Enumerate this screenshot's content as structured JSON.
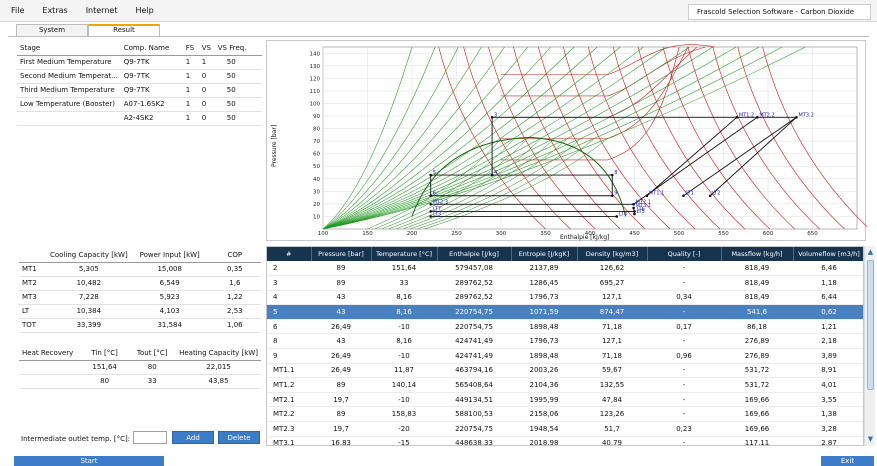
{
  "menu": {
    "items": [
      "File",
      "Extras",
      "Internet",
      "Help"
    ]
  },
  "window_title": "Frascold Selection Software - Carbon Dioxide",
  "tabs": [
    {
      "label": "System"
    },
    {
      "label": "Result"
    }
  ],
  "stage_table": {
    "headers": [
      "Stage",
      "Comp. Name",
      "FS",
      "VS",
      "VS Freq."
    ],
    "rows": [
      [
        "First Medium Temperature",
        "Q9-7TK",
        "1",
        "1",
        "50"
      ],
      [
        "Second Medium Temperat...",
        "Q9-7TK",
        "1",
        "0",
        "50"
      ],
      [
        "Third Medium Temperature",
        "Q9-7TK",
        "1",
        "0",
        "50"
      ],
      [
        "Low Temperature (Booster)",
        "A07-1.6SK2",
        "1",
        "0",
        "50"
      ],
      [
        "",
        "A2-4SK2",
        "1",
        "0",
        "50"
      ]
    ]
  },
  "capacity_table": {
    "headers": [
      "",
      "Cooling Capacity [kW]",
      "Power Input [kW]",
      "COP"
    ],
    "rows": [
      [
        "MT1",
        "5,305",
        "15,008",
        "0,35"
      ],
      [
        "MT2",
        "10,482",
        "6,549",
        "1,6"
      ],
      [
        "MT3",
        "7,228",
        "5,923",
        "1,22"
      ],
      [
        "LT",
        "10,384",
        "4,103",
        "2,53"
      ],
      [
        "TOT",
        "33,399",
        "31,584",
        "1,06"
      ]
    ]
  },
  "heat_recovery_table": {
    "headers": [
      "Heat Recovery",
      "Tin [°C]",
      "Tout [°C]",
      "Heating Capacity [kW]"
    ],
    "rows": [
      [
        "",
        "151,64",
        "80",
        "22,015"
      ],
      [
        "",
        "80",
        "33",
        "43,85"
      ]
    ]
  },
  "intermediate": {
    "label": "Intermediate outlet temp. [°C]:",
    "value": ""
  },
  "buttons": {
    "add": "Add",
    "delete": "Delete",
    "start": "Start",
    "exit": "Exit"
  },
  "grid": {
    "headers": [
      "#",
      "Pressure [bar]",
      "Temperature [°C]",
      "Enthalpie [J/kg]",
      "Entropie [J/kgK]",
      "Density [kg/m3]",
      "Quality [-]",
      "Massflow [kg/h]",
      "Volumeflow [m3/h]"
    ],
    "rows": [
      [
        "2",
        "89",
        "151,64",
        "579457,08",
        "2137,89",
        "126,62",
        "-",
        "818,49",
        "6,46"
      ],
      [
        "3",
        "89",
        "33",
        "289762,52",
        "1286,45",
        "695,27",
        "-",
        "818,49",
        "1,18"
      ],
      [
        "4",
        "43",
        "8,16",
        "289762,52",
        "1796,73",
        "127,1",
        "0,34",
        "818,49",
        "6,44"
      ],
      [
        "5",
        "43",
        "8,16",
        "220754,75",
        "1071,59",
        "874,47",
        "-",
        "541,6",
        "0,62"
      ],
      [
        "6",
        "26,49",
        "-10",
        "220754,75",
        "1898,48",
        "71,18",
        "0,17",
        "86,18",
        "1,21"
      ],
      [
        "8",
        "43",
        "8,16",
        "424741,49",
        "1796,73",
        "127,1",
        "-",
        "276,89",
        "2,18"
      ],
      [
        "9",
        "26,49",
        "-10",
        "424741,49",
        "1898,48",
        "71,18",
        "0,96",
        "276,89",
        "3,89"
      ],
      [
        "MT1.1",
        "26,49",
        "11,87",
        "463794,16",
        "2003,26",
        "59,67",
        "-",
        "531,72",
        "8,91"
      ],
      [
        "MT1.2",
        "89",
        "140,14",
        "565408,64",
        "2104,36",
        "132,55",
        "-",
        "531,72",
        "4,01"
      ],
      [
        "MT2.1",
        "19,7",
        "-10",
        "449134,51",
        "1995,99",
        "47,84",
        "-",
        "169,66",
        "3,55"
      ],
      [
        "MT2.2",
        "89",
        "158,83",
        "588100,53",
        "2158,06",
        "123,26",
        "-",
        "169,66",
        "1,38"
      ],
      [
        "MT2.3",
        "19,7",
        "-20",
        "220754,75",
        "1948,54",
        "51,7",
        "0,23",
        "169,66",
        "3,28"
      ],
      [
        "MT3.1",
        "16,83",
        "-15",
        "448638,33",
        "2018,98",
        "40,79",
        "-",
        "117,11",
        "2,87"
      ]
    ],
    "selected_row_index": 3
  },
  "chart_data": {
    "type": "line",
    "xlabel": "Enthalpie [kJ/kg]",
    "ylabel": "Pressure [bar]",
    "xlim": [
      100,
      700
    ],
    "ylim": [
      0,
      145
    ],
    "x_ticks": [
      100,
      150,
      200,
      250,
      300,
      350,
      400,
      450,
      500,
      550,
      600,
      650
    ],
    "y_ticks": [
      10,
      20,
      30,
      40,
      50,
      60,
      70,
      80,
      90,
      100,
      110,
      120,
      130,
      140
    ],
    "points": [
      {
        "label": "3",
        "h": 290,
        "p": 89
      },
      {
        "label": "4",
        "h": 290,
        "p": 43
      },
      {
        "label": "5",
        "h": 221,
        "p": 43
      },
      {
        "label": "6",
        "h": 221,
        "p": 26.5
      },
      {
        "label": "8",
        "h": 425,
        "p": 43
      },
      {
        "label": "9",
        "h": 425,
        "p": 26.5
      },
      {
        "label": "MT1.1",
        "h": 464,
        "p": 26.5
      },
      {
        "label": "MT1.2",
        "h": 565,
        "p": 89
      },
      {
        "label": "MT2.1",
        "h": 449,
        "p": 19.7
      },
      {
        "label": "MT2.2",
        "h": 588,
        "p": 89
      },
      {
        "label": "MT2.3",
        "h": 221,
        "p": 19.7
      },
      {
        "label": "MT3.1",
        "h": 449,
        "p": 16.8
      },
      {
        "label": "LT1",
        "h": 505,
        "p": 26.5
      },
      {
        "label": "MT3.2",
        "h": 632,
        "p": 89
      },
      {
        "label": "LT2",
        "h": 535,
        "p": 26.5
      },
      {
        "label": "LT3",
        "h": 221,
        "p": 10
      },
      {
        "label": "LT4",
        "h": 430,
        "p": 10
      },
      {
        "label": "LT5",
        "h": 450,
        "p": 12
      },
      {
        "label": "LT6",
        "h": 450,
        "p": 14
      },
      {
        "label": "LT7",
        "h": 221,
        "p": 14
      }
    ],
    "cycle_path": [
      [
        290,
        89
      ],
      [
        632,
        89
      ],
      [
        632,
        89
      ],
      [
        535,
        26.5
      ],
      [
        221,
        26.5
      ]
    ],
    "colors": {
      "isotherm": "#cc1f1f",
      "isentrope": "#1f9a1f",
      "quality": "#1f8f1f",
      "cycle": "#111111",
      "points": "#2222cc"
    },
    "grid": true
  },
  "colors": {
    "accent": "#3d7cc8",
    "header": "#17334f",
    "selected": "#4a80bf",
    "tab_active": "#f1a400"
  }
}
